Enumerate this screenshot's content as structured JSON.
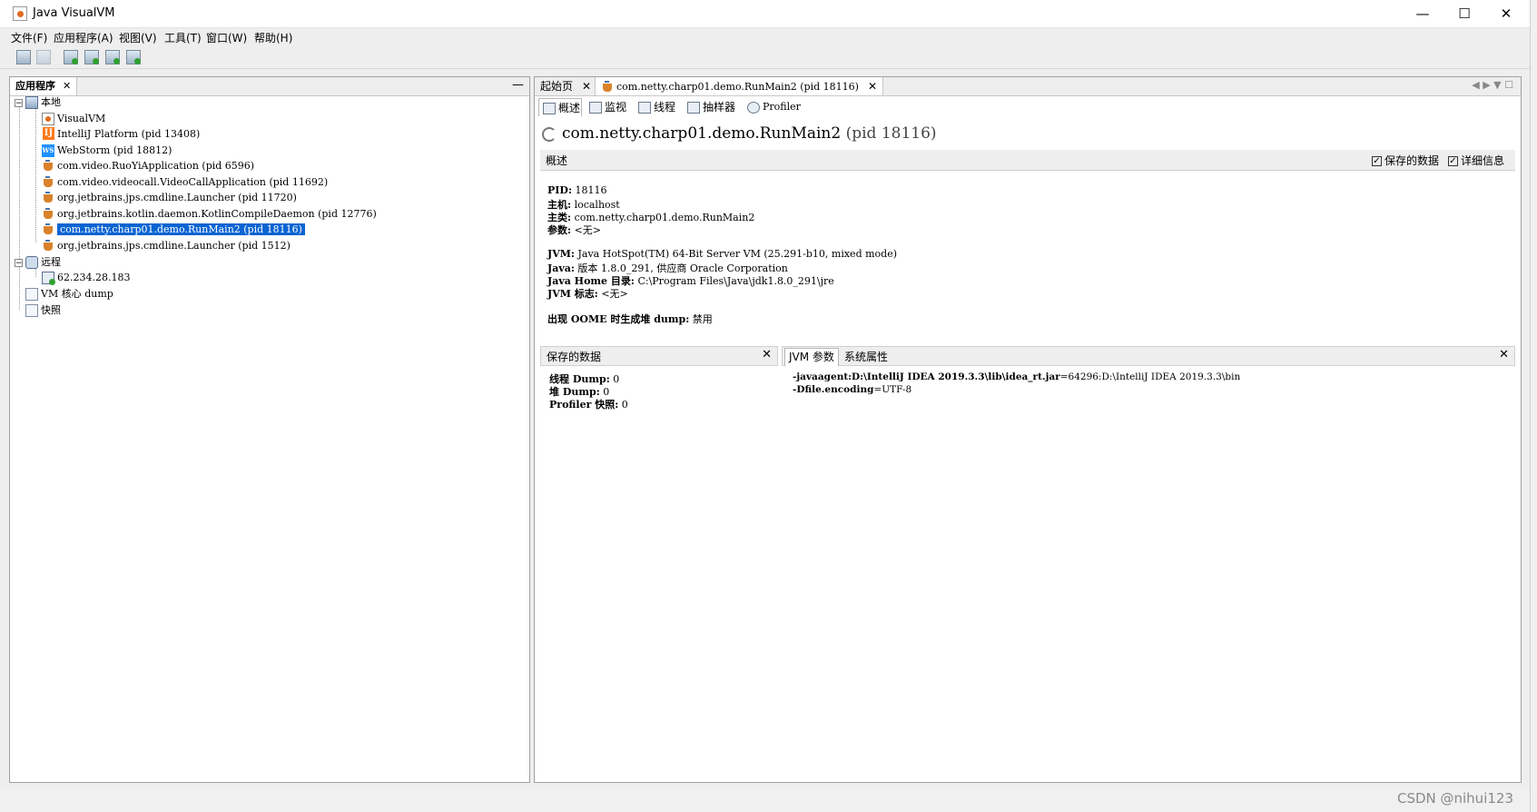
{
  "window": {
    "title": "Java VisualVM",
    "minimize": "—",
    "maximize": "☐",
    "close": "✕"
  },
  "menu": {
    "file": "文件(F)",
    "apps": "应用程序(A)",
    "view": "视图(V)",
    "tools": "工具(T)",
    "window": "窗口(W)",
    "help": "帮助(H)"
  },
  "left_panel": {
    "tab": "应用程序",
    "close": "✕",
    "minimize": "—",
    "tree": {
      "local": "本地",
      "items": [
        "VisualVM",
        "IntelliJ Platform (pid 13408)",
        "WebStorm (pid 18812)",
        "com.video.RuoYiApplication (pid 6596)",
        "com.video.videocall.VideoCallApplication (pid 11692)",
        "org.jetbrains.jps.cmdline.Launcher (pid 11720)",
        "org.jetbrains.kotlin.daemon.KotlinCompileDaemon (pid 12776)",
        "com.netty.charp01.demo.RunMain2 (pid 18116)",
        "org.jetbrains.jps.cmdline.Launcher (pid 1512)"
      ],
      "remote": "远程",
      "remote_host": "62.234.28.183",
      "vm_dump": "VM 核心 dump",
      "snapshots": "快照",
      "expand_minus": "−"
    }
  },
  "right_panel": {
    "tabs": {
      "start": "起始页",
      "app": "com.netty.charp01.demo.RunMain2 (pid 18116)",
      "close": "✕"
    },
    "nav": "◀ ▶ ▼ ☐",
    "subtabs": {
      "overview": "概述",
      "monitor": "监视",
      "threads": "线程",
      "sampler": "抽样器",
      "profiler": "Profiler"
    },
    "process_title": "com.netty.charp01.demo.RunMain2",
    "process_pid": "(pid 18116)",
    "section_label": "概述",
    "checkbox_saved": "保存的数据",
    "checkbox_details": "详细信息",
    "checkmark": "✓",
    "info": {
      "pid_label": "PID:",
      "pid_value": "18116",
      "host_label": "主机:",
      "host_value": "localhost",
      "main_label": "主类:",
      "main_value": "com.netty.charp01.demo.RunMain2",
      "args_label": "参数:",
      "args_value": "<无>",
      "jvm_label": "JVM:",
      "jvm_value": "Java HotSpot(TM) 64-Bit Server VM (25.291-b10, mixed mode)",
      "java_label": "Java:",
      "java_value": "版本 1.8.0_291, 供应商 Oracle Corporation",
      "home_label": "Java Home 目录:",
      "home_value": "C:\\Program Files\\Java\\jdk1.8.0_291\\jre",
      "flags_label": "JVM 标志:",
      "flags_value": "<无>",
      "oome_label": "出现 OOME 时生成堆 dump:",
      "oome_value": "禁用"
    },
    "saved_panel": {
      "title": "保存的数据",
      "close": "✕",
      "thread_dump_label": "线程 Dump:",
      "thread_dump_value": "0",
      "heap_dump_label": "堆 Dump:",
      "heap_dump_value": "0",
      "profiler_label": "Profiler 快照:",
      "profiler_value": "0"
    },
    "jvm_panel": {
      "tab_args": "JVM 参数",
      "tab_props": "系统属性",
      "close": "✕",
      "arg1_bold": "-javaagent:D:\\IntelliJ  IDEA  2019.3.3\\lib\\idea_rt.jar",
      "arg1_rest": "=64296:D:\\IntelliJ  IDEA  2019.3.3\\bin",
      "arg2_bold": "-Dfile.encoding",
      "arg2_rest": "=UTF-8"
    }
  },
  "watermark": "CSDN @nihui123"
}
